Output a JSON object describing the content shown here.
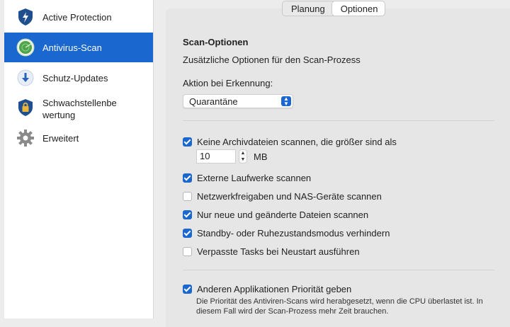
{
  "sidebar": {
    "items": [
      {
        "label": "Active Protection",
        "icon": "shield-lightning-icon",
        "active": false
      },
      {
        "label": "Antivirus-Scan",
        "icon": "radar-scan-icon",
        "active": true
      },
      {
        "label": "Schutz-Updates",
        "icon": "download-arrow-icon",
        "active": false
      },
      {
        "label": "Schwachstellenbe wertung",
        "line1": "Schwachstellenbe",
        "line2": "wertung",
        "icon": "shield-lock-icon",
        "active": false
      },
      {
        "label": "Erweitert",
        "icon": "gear-icon",
        "active": false
      }
    ],
    "accent_color": "#1a67cf"
  },
  "tabs": [
    {
      "label": "Planung",
      "selected": false
    },
    {
      "label": "Optionen",
      "selected": true
    }
  ],
  "options": {
    "title": "Scan-Optionen",
    "subtitle": "Zusätzliche Optionen für den Scan-Prozess",
    "action_label": "Aktion bei Erkennung:",
    "action_value": "Quarantäne",
    "checkboxes": [
      {
        "label": "Keine Archivdateien scannen, die größer sind als",
        "checked": true
      },
      {
        "label": "Externe Laufwerke scannen",
        "checked": true
      },
      {
        "label": "Netzwerkfreigaben und NAS-Geräte scannen",
        "checked": false
      },
      {
        "label": "Nur neue und geänderte Dateien scannen",
        "checked": true
      },
      {
        "label": "Standby- oder Ruhezustandsmodus verhindern",
        "checked": true
      },
      {
        "label": "Verpasste Tasks bei Neustart ausführen",
        "checked": false
      }
    ],
    "archive_size_value": "10",
    "archive_size_unit": "MB",
    "priority": {
      "label": "Anderen Applikationen Priorität geben",
      "checked": true,
      "description": "Die Priorität des Antiviren-Scans wird herabgesetzt, wenn die CPU überlastet ist. In diesem Fall wird der Scan-Prozess mehr Zeit brauchen."
    }
  }
}
